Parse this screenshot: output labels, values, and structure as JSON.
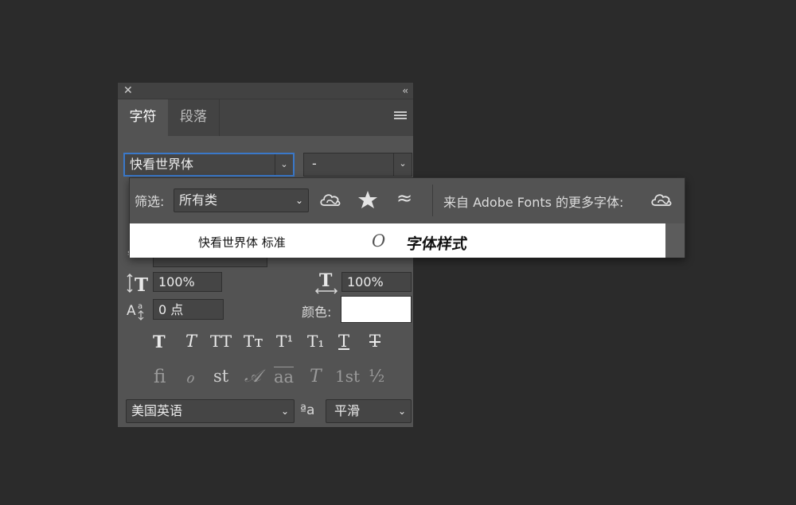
{
  "panel": {
    "close_symbol": "✕",
    "collapse_symbol": "‹‹",
    "tabs": [
      {
        "label": "字符",
        "active": true
      },
      {
        "label": "段落",
        "active": false
      }
    ],
    "font_family": "快看世界体",
    "font_style": "-",
    "vertical_scale": "100%",
    "horizontal_scale": "100%",
    "baseline_shift": "0 点",
    "color_label": "颜色:",
    "color_value": "#ffffff",
    "style_buttons": [
      "T",
      "T",
      "TT",
      "Tт",
      "T¹",
      "T₁",
      "T",
      "T"
    ],
    "opentype_buttons": [
      "ﬁ",
      "ℴ",
      "st",
      "𝒜",
      "aa",
      "T",
      "1st",
      "½"
    ],
    "language": "美国英语",
    "aa_label": "ªa",
    "antialias": "平滑"
  },
  "popup": {
    "filter_label": "筛选:",
    "filter_value": "所有类",
    "more_fonts_label": "来自 Adobe Fonts 的更多字体:",
    "font_items": [
      {
        "name": "快看世界体 标准",
        "type_badge": "O",
        "preview": "字体样式"
      }
    ]
  }
}
